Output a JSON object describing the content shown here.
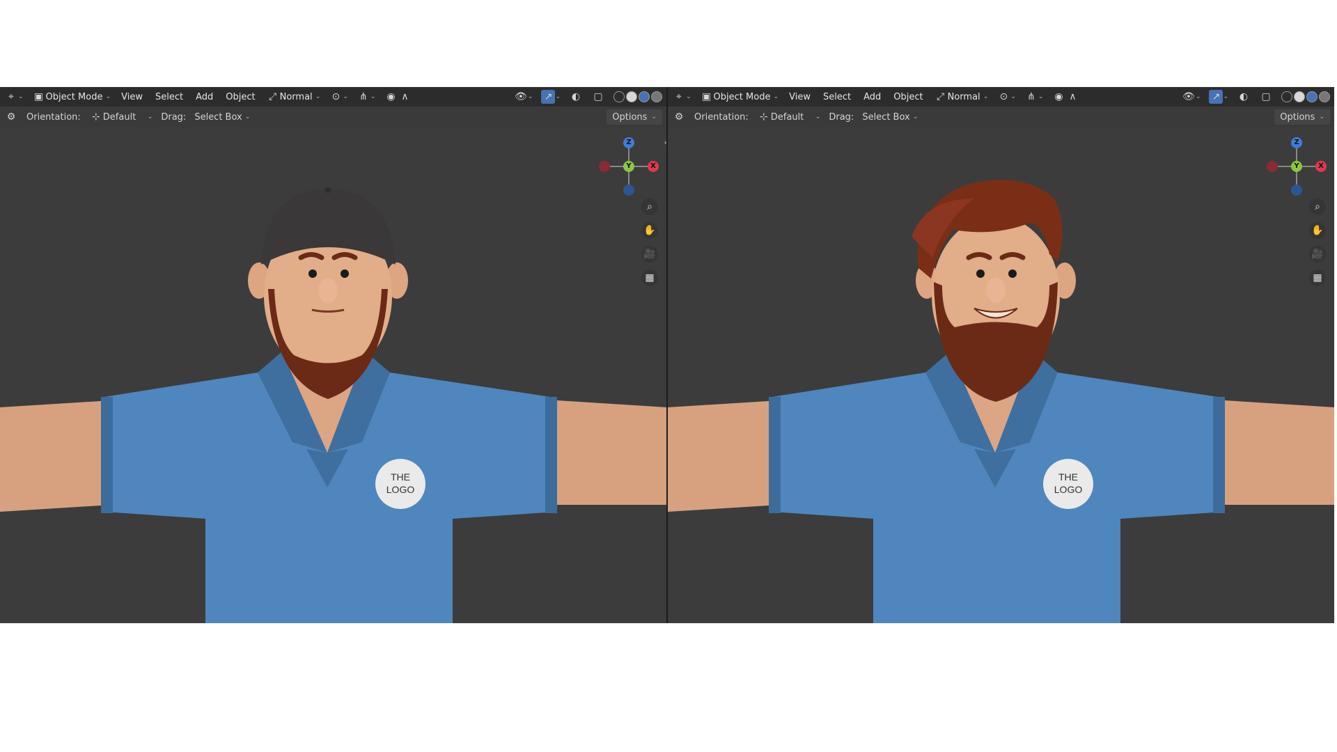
{
  "viewports": [
    {
      "id": "left",
      "header": {
        "mode_label": "Object Mode",
        "menus": [
          "View",
          "Select",
          "Add",
          "Object"
        ],
        "orientation_dropdown": "Normal"
      },
      "tool_header": {
        "orientation_label": "Orientation:",
        "orientation_value": "Default",
        "drag_label": "Drag:",
        "drag_value": "Select Box",
        "options_label": "Options"
      },
      "gizmo": {
        "z": "Z",
        "y": "Y",
        "x": "X"
      },
      "logo": {
        "line1": "THE",
        "line2": "LOGO"
      },
      "character": {
        "hair": "cap",
        "cap_color": "#3a3838",
        "beard_color": "#6b2a16"
      }
    },
    {
      "id": "right",
      "header": {
        "mode_label": "Object Mode",
        "menus": [
          "View",
          "Select",
          "Add",
          "Object"
        ],
        "orientation_dropdown": "Normal"
      },
      "tool_header": {
        "orientation_label": "Orientation:",
        "orientation_value": "Default",
        "drag_label": "Drag:",
        "drag_value": "Select Box",
        "options_label": "Options"
      },
      "gizmo": {
        "z": "Z",
        "y": "Y",
        "x": "X"
      },
      "logo": {
        "line1": "THE",
        "line2": "LOGO"
      },
      "character": {
        "hair": "quiff",
        "hair_color": "#7a2e16",
        "beard_color": "#6b2a16"
      }
    }
  ],
  "colors": {
    "viewport_bg": "#3c3c3c",
    "header_bg": "#2c2c2c",
    "shirt": "#4f86bd",
    "skin": "#e0ab88",
    "axis_x": "#e0384e",
    "axis_y": "#8bc63f",
    "axis_z": "#3d7fd6"
  },
  "icons": [
    "editor-type-icon",
    "object-mode-icon",
    "transform-orientation-icon",
    "pivot-icon",
    "snap-icon",
    "proportional-edit-icon",
    "visibility-icon",
    "gizmo-icon",
    "overlay-icon",
    "xray-icon",
    "wireframe-shading-icon",
    "solid-shading-icon",
    "material-shading-icon",
    "rendered-shading-icon",
    "tool-settings-icon",
    "zoom-icon",
    "pan-hand-icon",
    "camera-icon",
    "grid-icon"
  ]
}
